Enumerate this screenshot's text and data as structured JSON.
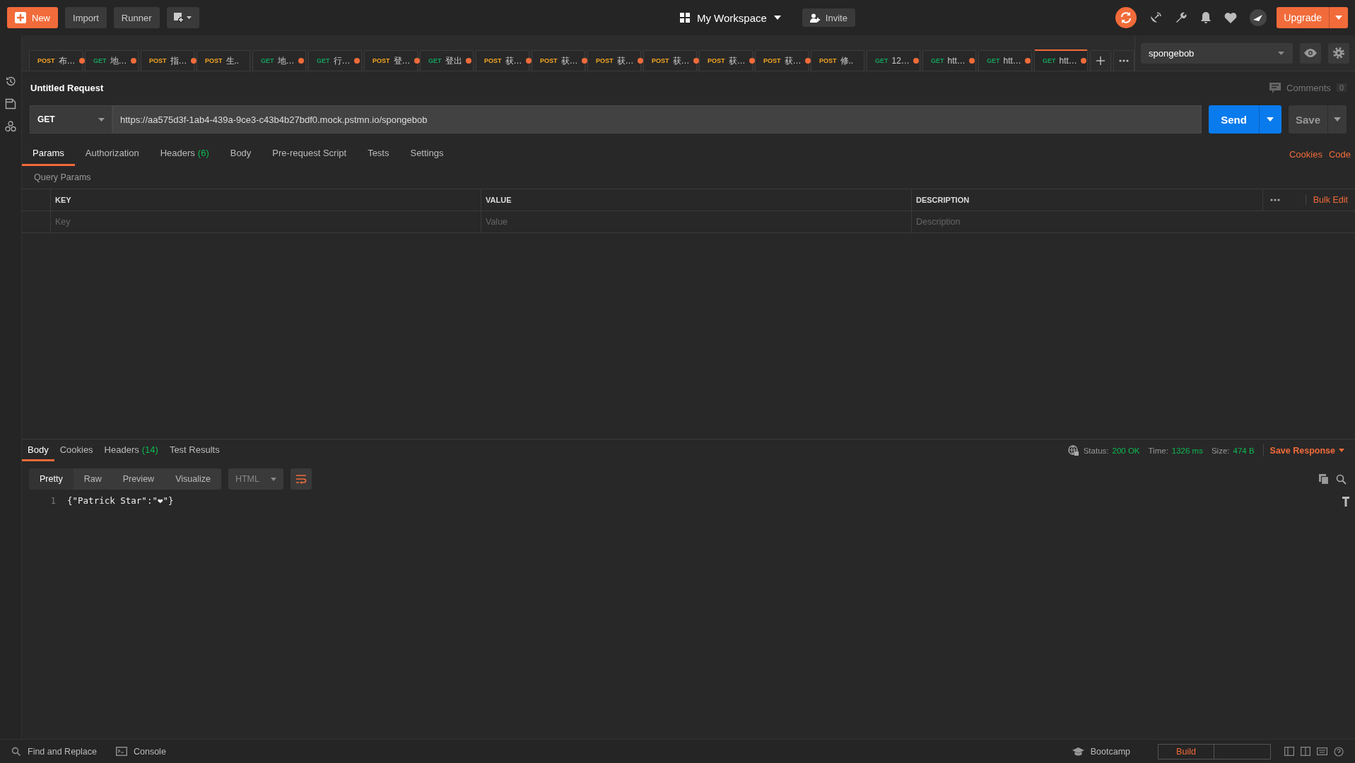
{
  "top_bar": {
    "new": "New",
    "import": "Import",
    "runner": "Runner",
    "workspace": "My Workspace",
    "invite": "Invite",
    "upgrade": "Upgrade"
  },
  "request_tabs": [
    {
      "method": "POST",
      "color": "#f5a623",
      "title": "布…",
      "unsaved": true,
      "selected": false
    },
    {
      "method": "GET",
      "color": "#12a05c",
      "title": "地…",
      "unsaved": true,
      "selected": false
    },
    {
      "method": "POST",
      "color": "#f5a623",
      "title": "指…",
      "unsaved": true,
      "selected": false
    },
    {
      "method": "POST",
      "color": "#f5a623",
      "title": "生..",
      "unsaved": false,
      "selected": false
    },
    {
      "method": "GET",
      "color": "#12a05c",
      "title": "地…",
      "unsaved": true,
      "selected": false
    },
    {
      "method": "GET",
      "color": "#12a05c",
      "title": "行…",
      "unsaved": true,
      "selected": false
    },
    {
      "method": "POST",
      "color": "#f5a623",
      "title": "登…",
      "unsaved": true,
      "selected": false
    },
    {
      "method": "GET",
      "color": "#12a05c",
      "title": "登出",
      "unsaved": true,
      "selected": false
    },
    {
      "method": "POST",
      "color": "#f5a623",
      "title": "获…",
      "unsaved": true,
      "selected": false
    },
    {
      "method": "POST",
      "color": "#f5a623",
      "title": "获…",
      "unsaved": true,
      "selected": false
    },
    {
      "method": "POST",
      "color": "#f5a623",
      "title": "获…",
      "unsaved": true,
      "selected": false
    },
    {
      "method": "POST",
      "color": "#f5a623",
      "title": "获…",
      "unsaved": true,
      "selected": false
    },
    {
      "method": "POST",
      "color": "#f5a623",
      "title": "获…",
      "unsaved": true,
      "selected": false
    },
    {
      "method": "POST",
      "color": "#f5a623",
      "title": "获…",
      "unsaved": true,
      "selected": false
    },
    {
      "method": "POST",
      "color": "#f5a623",
      "title": "修..",
      "unsaved": false,
      "selected": false
    },
    {
      "method": "GET",
      "color": "#12a05c",
      "title": "12…",
      "unsaved": true,
      "selected": false
    },
    {
      "method": "GET",
      "color": "#12a05c",
      "title": "htt…",
      "unsaved": true,
      "selected": false
    },
    {
      "method": "GET",
      "color": "#12a05c",
      "title": "htt…",
      "unsaved": true,
      "selected": false
    },
    {
      "method": "GET",
      "color": "#12a05c",
      "title": "htt…",
      "unsaved": true,
      "selected": true
    }
  ],
  "environment": "spongebob",
  "request": {
    "title": "Untitled Request",
    "comments": "Comments",
    "comments_count": "0",
    "method": "GET",
    "url": "https://aa575d3f-1ab4-439a-9ce3-c43b4b27bdf0.mock.pstmn.io/spongebob",
    "send": "Send",
    "save": "Save"
  },
  "request_subtabs": [
    {
      "label": "Params",
      "selected": true
    },
    {
      "label": "Authorization",
      "selected": false
    },
    {
      "label": "Headers",
      "count": "(6)",
      "selected": false
    },
    {
      "label": "Body",
      "selected": false
    },
    {
      "label": "Pre-request Script",
      "selected": false
    },
    {
      "label": "Tests",
      "selected": false
    },
    {
      "label": "Settings",
      "selected": false
    }
  ],
  "request_links": [
    "Cookies",
    "Code"
  ],
  "query_params": {
    "title": "Query Params",
    "columns": [
      "KEY",
      "VALUE",
      "DESCRIPTION"
    ],
    "bulk_edit": "Bulk Edit",
    "placeholders": [
      "Key",
      "Value",
      "Description"
    ]
  },
  "response": {
    "tabs": [
      {
        "label": "Body",
        "selected": true
      },
      {
        "label": "Cookies",
        "selected": false
      },
      {
        "label": "Headers",
        "count": "(14)",
        "selected": false
      },
      {
        "label": "Test Results",
        "selected": false
      }
    ],
    "status_label": "Status:",
    "status": "200 OK",
    "time_label": "Time:",
    "time": "1326 ms",
    "size_label": "Size:",
    "size": "474 B",
    "save_response": "Save Response",
    "view_modes": [
      {
        "label": "Pretty",
        "selected": true
      },
      {
        "label": "Raw",
        "selected": false
      },
      {
        "label": "Preview",
        "selected": false
      },
      {
        "label": "Visualize",
        "selected": false
      }
    ],
    "format": "HTML",
    "lines": [
      {
        "number": "1",
        "text": "{\"Patrick Star\":\"❤\"}"
      }
    ]
  },
  "status_bar": {
    "find_replace": "Find and Replace",
    "console": "Console",
    "bootcamp": "Bootcamp",
    "build": "Build"
  }
}
